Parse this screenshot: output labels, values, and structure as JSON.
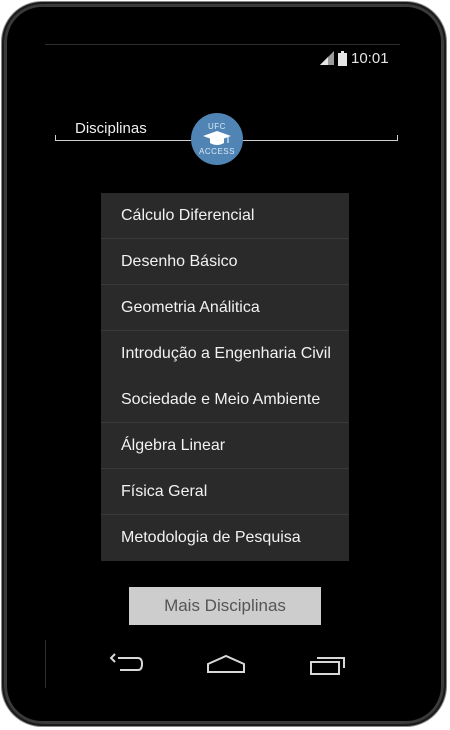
{
  "status": {
    "time": "10:01",
    "icons": [
      "signal-icon",
      "battery-icon"
    ]
  },
  "header": {
    "title": "Disciplinas",
    "logo_lines": [
      "UFC",
      "ACCESS"
    ]
  },
  "menu": {
    "items": [
      "Cálculo Diferencial",
      "Desenho Básico",
      "Geometria Análitica",
      "Introdução a Engenharia Civil",
      "Sociedade e Meio Ambiente",
      "Álgebra Linear",
      "Física Geral",
      "Metodologia de Pesquisa"
    ]
  },
  "actions": {
    "more_label": "Mais Disciplinas"
  },
  "navbar": {
    "icons": [
      "back-icon",
      "home-icon",
      "recents-icon"
    ]
  },
  "colors": {
    "logo": "#4f84b4",
    "menu_bg": "#2a2a2a",
    "button_bg": "#cdcdcd"
  }
}
